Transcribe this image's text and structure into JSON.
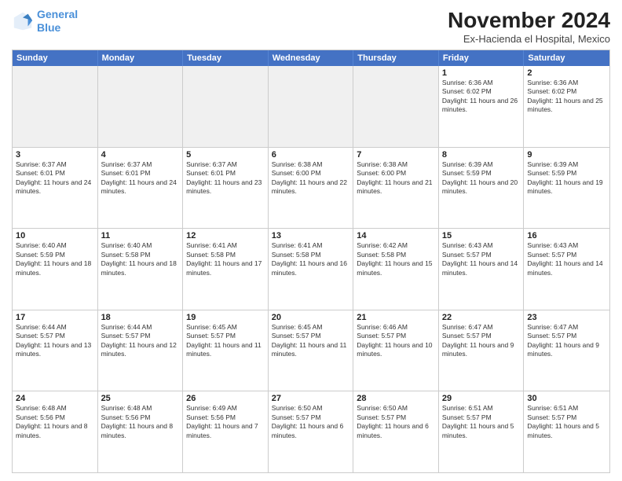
{
  "logo": {
    "line1": "General",
    "line2": "Blue"
  },
  "title": "November 2024",
  "subtitle": "Ex-Hacienda el Hospital, Mexico",
  "header_days": [
    "Sunday",
    "Monday",
    "Tuesday",
    "Wednesday",
    "Thursday",
    "Friday",
    "Saturday"
  ],
  "rows": [
    [
      {
        "day": "",
        "info": ""
      },
      {
        "day": "",
        "info": ""
      },
      {
        "day": "",
        "info": ""
      },
      {
        "day": "",
        "info": ""
      },
      {
        "day": "",
        "info": ""
      },
      {
        "day": "1",
        "info": "Sunrise: 6:36 AM\nSunset: 6:02 PM\nDaylight: 11 hours and 26 minutes."
      },
      {
        "day": "2",
        "info": "Sunrise: 6:36 AM\nSunset: 6:02 PM\nDaylight: 11 hours and 25 minutes."
      }
    ],
    [
      {
        "day": "3",
        "info": "Sunrise: 6:37 AM\nSunset: 6:01 PM\nDaylight: 11 hours and 24 minutes."
      },
      {
        "day": "4",
        "info": "Sunrise: 6:37 AM\nSunset: 6:01 PM\nDaylight: 11 hours and 24 minutes."
      },
      {
        "day": "5",
        "info": "Sunrise: 6:37 AM\nSunset: 6:01 PM\nDaylight: 11 hours and 23 minutes."
      },
      {
        "day": "6",
        "info": "Sunrise: 6:38 AM\nSunset: 6:00 PM\nDaylight: 11 hours and 22 minutes."
      },
      {
        "day": "7",
        "info": "Sunrise: 6:38 AM\nSunset: 6:00 PM\nDaylight: 11 hours and 21 minutes."
      },
      {
        "day": "8",
        "info": "Sunrise: 6:39 AM\nSunset: 5:59 PM\nDaylight: 11 hours and 20 minutes."
      },
      {
        "day": "9",
        "info": "Sunrise: 6:39 AM\nSunset: 5:59 PM\nDaylight: 11 hours and 19 minutes."
      }
    ],
    [
      {
        "day": "10",
        "info": "Sunrise: 6:40 AM\nSunset: 5:59 PM\nDaylight: 11 hours and 18 minutes."
      },
      {
        "day": "11",
        "info": "Sunrise: 6:40 AM\nSunset: 5:58 PM\nDaylight: 11 hours and 18 minutes."
      },
      {
        "day": "12",
        "info": "Sunrise: 6:41 AM\nSunset: 5:58 PM\nDaylight: 11 hours and 17 minutes."
      },
      {
        "day": "13",
        "info": "Sunrise: 6:41 AM\nSunset: 5:58 PM\nDaylight: 11 hours and 16 minutes."
      },
      {
        "day": "14",
        "info": "Sunrise: 6:42 AM\nSunset: 5:58 PM\nDaylight: 11 hours and 15 minutes."
      },
      {
        "day": "15",
        "info": "Sunrise: 6:43 AM\nSunset: 5:57 PM\nDaylight: 11 hours and 14 minutes."
      },
      {
        "day": "16",
        "info": "Sunrise: 6:43 AM\nSunset: 5:57 PM\nDaylight: 11 hours and 14 minutes."
      }
    ],
    [
      {
        "day": "17",
        "info": "Sunrise: 6:44 AM\nSunset: 5:57 PM\nDaylight: 11 hours and 13 minutes."
      },
      {
        "day": "18",
        "info": "Sunrise: 6:44 AM\nSunset: 5:57 PM\nDaylight: 11 hours and 12 minutes."
      },
      {
        "day": "19",
        "info": "Sunrise: 6:45 AM\nSunset: 5:57 PM\nDaylight: 11 hours and 11 minutes."
      },
      {
        "day": "20",
        "info": "Sunrise: 6:45 AM\nSunset: 5:57 PM\nDaylight: 11 hours and 11 minutes."
      },
      {
        "day": "21",
        "info": "Sunrise: 6:46 AM\nSunset: 5:57 PM\nDaylight: 11 hours and 10 minutes."
      },
      {
        "day": "22",
        "info": "Sunrise: 6:47 AM\nSunset: 5:57 PM\nDaylight: 11 hours and 9 minutes."
      },
      {
        "day": "23",
        "info": "Sunrise: 6:47 AM\nSunset: 5:57 PM\nDaylight: 11 hours and 9 minutes."
      }
    ],
    [
      {
        "day": "24",
        "info": "Sunrise: 6:48 AM\nSunset: 5:56 PM\nDaylight: 11 hours and 8 minutes."
      },
      {
        "day": "25",
        "info": "Sunrise: 6:48 AM\nSunset: 5:56 PM\nDaylight: 11 hours and 8 minutes."
      },
      {
        "day": "26",
        "info": "Sunrise: 6:49 AM\nSunset: 5:56 PM\nDaylight: 11 hours and 7 minutes."
      },
      {
        "day": "27",
        "info": "Sunrise: 6:50 AM\nSunset: 5:57 PM\nDaylight: 11 hours and 6 minutes."
      },
      {
        "day": "28",
        "info": "Sunrise: 6:50 AM\nSunset: 5:57 PM\nDaylight: 11 hours and 6 minutes."
      },
      {
        "day": "29",
        "info": "Sunrise: 6:51 AM\nSunset: 5:57 PM\nDaylight: 11 hours and 5 minutes."
      },
      {
        "day": "30",
        "info": "Sunrise: 6:51 AM\nSunset: 5:57 PM\nDaylight: 11 hours and 5 minutes."
      }
    ]
  ]
}
